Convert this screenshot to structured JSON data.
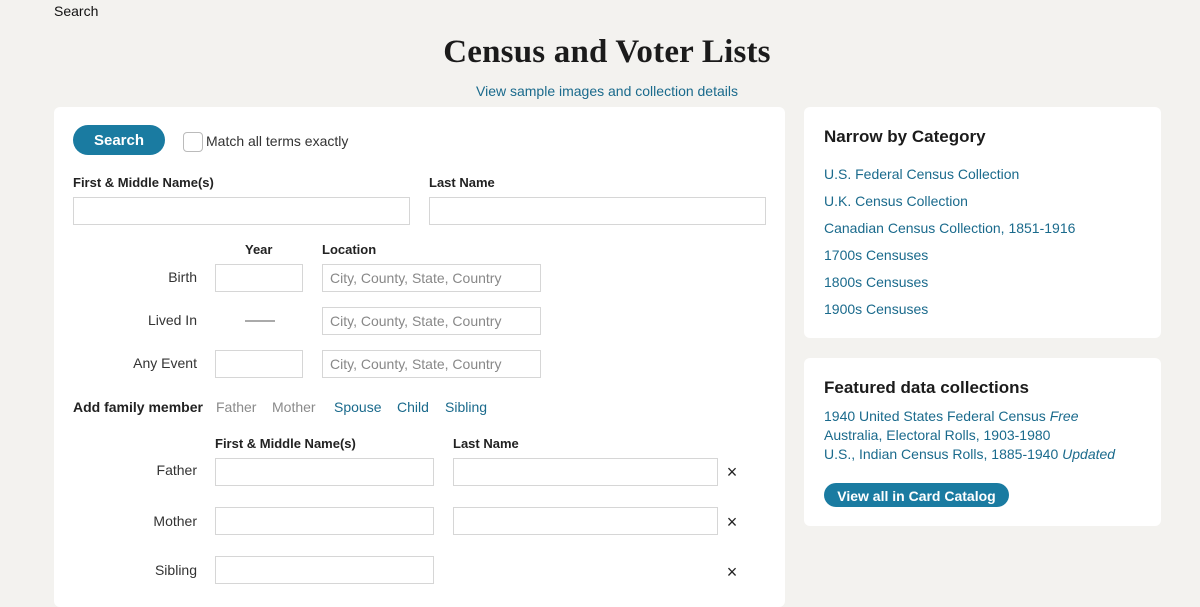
{
  "breadcrumb": "Search",
  "page_title": "Census and Voter Lists",
  "sample_link": "View sample images and collection details",
  "search_form": {
    "search_button": "Search",
    "match_exact_label": "Match all terms exactly",
    "match_exact_checked": false,
    "first_name_label": "First & Middle Name(s)",
    "first_name_value": "",
    "last_name_label": "Last Name",
    "last_name_value": "",
    "year_header": "Year",
    "location_header": "Location",
    "location_placeholder": "City, County, State, Country",
    "events": [
      {
        "label": "Birth",
        "year": "",
        "location": ""
      },
      {
        "label": "Lived In",
        "year": null,
        "location": ""
      },
      {
        "label": "Any Event",
        "year": "",
        "location": ""
      }
    ],
    "add_family_label": "Add family member",
    "family_links": [
      {
        "label": "Father",
        "enabled": false
      },
      {
        "label": "Mother",
        "enabled": false
      },
      {
        "label": "Spouse",
        "enabled": true
      },
      {
        "label": "Child",
        "enabled": true
      },
      {
        "label": "Sibling",
        "enabled": true
      }
    ],
    "family_first_header": "First & Middle Name(s)",
    "family_last_header": "Last Name",
    "family_members": [
      {
        "label": "Father",
        "first": "",
        "last": ""
      },
      {
        "label": "Mother",
        "first": "",
        "last": ""
      },
      {
        "label": "Sibling",
        "first": ""
      }
    ],
    "remove_icon": "×"
  },
  "narrow_by_category": {
    "title": "Narrow by Category",
    "links": [
      "U.S. Federal Census Collection",
      "U.K. Census Collection",
      "Canadian Census Collection, 1851-1916",
      "1700s Censuses",
      "1800s Censuses",
      "1900s Censuses"
    ]
  },
  "featured": {
    "title": "Featured data collections",
    "items": [
      {
        "label": "1940 United States Federal Census",
        "tag": "Free"
      },
      {
        "label": "Australia, Electoral Rolls, 1903-1980",
        "tag": ""
      },
      {
        "label": "U.S., Indian Census Rolls, 1885-1940",
        "tag": "Updated"
      }
    ],
    "catalog_button": "View all in Card Catalog"
  },
  "colors": {
    "accent": "#1a7ba1",
    "link": "#1a6a8c",
    "background": "#f3f2ef"
  }
}
